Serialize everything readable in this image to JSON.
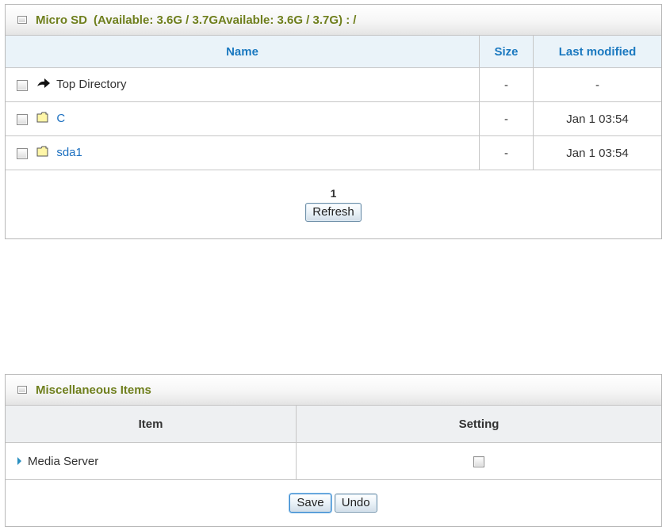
{
  "micro_sd": {
    "title": "Micro SD",
    "availability": "(Available: 3.6G / 3.7GAvailable: 3.6G / 3.7G) :",
    "path": "/",
    "columns": {
      "name": "Name",
      "size": "Size",
      "modified": "Last modified"
    },
    "rows": [
      {
        "name": "Top Directory",
        "size": "-",
        "modified": "-",
        "icon": "up-arrow-icon"
      },
      {
        "name": "C",
        "size": "-",
        "modified": "Jan 1 03:54",
        "icon": "folder-icon"
      },
      {
        "name": "sda1",
        "size": "-",
        "modified": "Jan 1 03:54",
        "icon": "folder-icon"
      }
    ],
    "page": "1",
    "refresh_label": "Refresh"
  },
  "misc": {
    "title": "Miscellaneous Items",
    "columns": {
      "item": "Item",
      "setting": "Setting"
    },
    "rows": [
      {
        "label": "Media Server",
        "enabled": false
      }
    ],
    "save_label": "Save",
    "undo_label": "Undo"
  },
  "colors": {
    "header_text": "#6f7f1d",
    "column_header": "#1b79c0",
    "link": "#1b6fc0"
  }
}
